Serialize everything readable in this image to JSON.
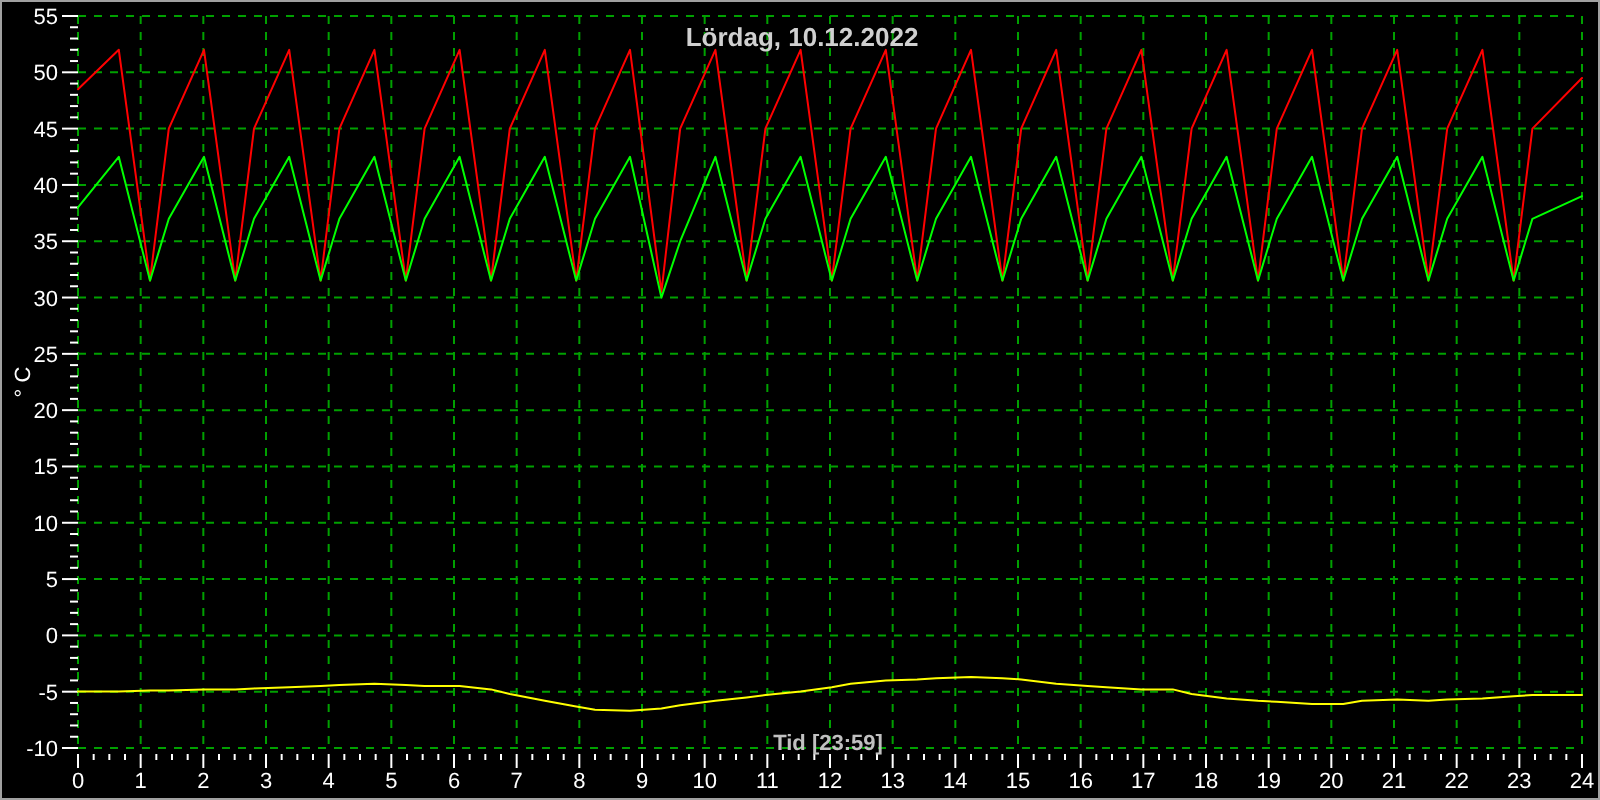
{
  "chart_data": {
    "type": "line",
    "title": "Lördag, 10.12.2022",
    "xlabel": "Tid [23:59]",
    "ylabel": "° C",
    "x": [
      0,
      0.65,
      1.15,
      1.45,
      2.01,
      2.51,
      2.81,
      3.37,
      3.87,
      4.17,
      4.73,
      5.23,
      5.53,
      6.09,
      6.59,
      6.89,
      7.45,
      7.95,
      8.25,
      8.81,
      9.31,
      9.61,
      10.17,
      10.67,
      10.97,
      11.53,
      12.03,
      12.33,
      12.89,
      13.39,
      13.69,
      14.25,
      14.75,
      15.05,
      15.61,
      16.11,
      16.41,
      16.97,
      17.47,
      17.77,
      18.33,
      18.83,
      19.13,
      19.69,
      20.19,
      20.49,
      21.05,
      21.55,
      21.85,
      22.41,
      22.91,
      23.21,
      24
    ],
    "series": [
      {
        "color": "#ff0000",
        "values": [
          48.5,
          52,
          31.5,
          45,
          52,
          31.5,
          45,
          52,
          31.5,
          45,
          52,
          31.5,
          45,
          52,
          31.5,
          45,
          52,
          31.5,
          45,
          52,
          30.5,
          45,
          52,
          31.5,
          45,
          52,
          31.5,
          45,
          52,
          31.5,
          45,
          52,
          31.5,
          45,
          52,
          31.5,
          45,
          52,
          31.5,
          45,
          52,
          31.5,
          45,
          52,
          31.5,
          45,
          52,
          31.5,
          45,
          52,
          31.5,
          45,
          49.5
        ]
      },
      {
        "color": "#00ff00",
        "values": [
          38,
          42.5,
          31.5,
          37,
          42.5,
          31.5,
          37,
          42.5,
          31.5,
          37,
          42.5,
          31.5,
          37,
          42.5,
          31.5,
          37,
          42.5,
          31.5,
          37,
          42.5,
          30,
          35,
          42.5,
          31.5,
          37,
          42.5,
          31.5,
          37,
          42.5,
          31.5,
          37,
          42.5,
          31.5,
          37,
          42.5,
          31.5,
          37,
          42.5,
          31.5,
          37,
          42.5,
          31.5,
          37,
          42.5,
          31.5,
          37,
          42.5,
          31.5,
          37,
          42.5,
          31.5,
          37,
          39
        ]
      },
      {
        "color": "#ffff00",
        "values": [
          -5,
          -5,
          -4.9,
          -4.9,
          -4.8,
          -4.8,
          -4.7,
          -4.6,
          -4.5,
          -4.4,
          -4.3,
          -4.4,
          -4.5,
          -4.5,
          -4.8,
          -5.2,
          -5.8,
          -6.3,
          -6.6,
          -6.7,
          -6.5,
          -6.2,
          -5.8,
          -5.5,
          -5.3,
          -5,
          -4.6,
          -4.3,
          -4,
          -3.9,
          -3.8,
          -3.7,
          -3.8,
          -3.9,
          -4.3,
          -4.5,
          -4.6,
          -4.8,
          -4.8,
          -5.2,
          -5.6,
          -5.8,
          -5.9,
          -6.1,
          -6.1,
          -5.8,
          -5.7,
          -5.8,
          -5.7,
          -5.6,
          -5.4,
          -5.3,
          -5.3
        ]
      }
    ],
    "grid": true,
    "xlim": [
      0,
      24
    ],
    "ylim": [
      -10,
      55
    ],
    "xticks": [
      0,
      1,
      2,
      3,
      4,
      5,
      6,
      7,
      8,
      9,
      10,
      11,
      12,
      13,
      14,
      15,
      16,
      17,
      18,
      19,
      20,
      21,
      22,
      23,
      24
    ],
    "yticks": [
      -10,
      -5,
      0,
      5,
      10,
      15,
      20,
      25,
      30,
      35,
      40,
      45,
      50,
      55
    ]
  }
}
